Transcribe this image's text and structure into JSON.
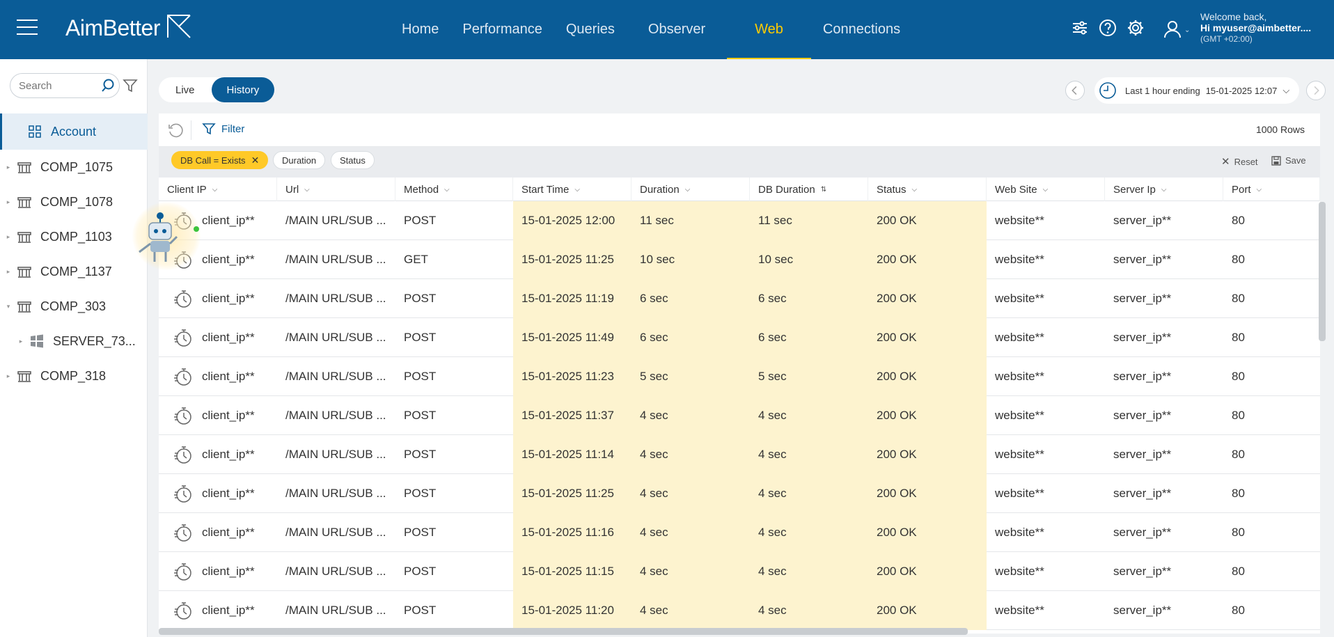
{
  "brand": {
    "name": "AimBetter"
  },
  "nav": {
    "items": [
      {
        "label": "Home"
      },
      {
        "label": "Performance"
      },
      {
        "label": "Queries"
      },
      {
        "label": "Observer"
      },
      {
        "label": "Web"
      },
      {
        "label": "Connections"
      }
    ],
    "active": "Web"
  },
  "user": {
    "welcome": "Welcome back,",
    "name": "Hi myuser@aimbetter....",
    "timezone": "(GMT +02:00)"
  },
  "sidebar": {
    "search_placeholder": "Search",
    "items": [
      {
        "label": "Account",
        "icon": "grid-icon",
        "active": true
      },
      {
        "label": "COMP_1075",
        "icon": "building-icon"
      },
      {
        "label": "COMP_1078",
        "icon": "building-icon"
      },
      {
        "label": "COMP_1103",
        "icon": "building-icon"
      },
      {
        "label": "COMP_1137",
        "icon": "building-icon"
      },
      {
        "label": "COMP_303",
        "icon": "building-icon",
        "expanded": true
      },
      {
        "label": "SERVER_73...",
        "icon": "windows-icon",
        "sub": true
      },
      {
        "label": "COMP_318",
        "icon": "building-icon"
      }
    ]
  },
  "view_toggle": {
    "live": "Live",
    "history": "History",
    "active": "History"
  },
  "time_range": {
    "label": "Last 1 hour ending",
    "end": "15-01-2025 12:07"
  },
  "toolbar": {
    "filter_label": "Filter",
    "rows_count": "1000 Rows"
  },
  "chips": {
    "active_filter": "DB Call = Exists",
    "duration": "Duration",
    "status": "Status",
    "reset": "Reset",
    "save": "Save"
  },
  "table": {
    "columns": [
      "Client IP",
      "Url",
      "Method",
      "Start Time",
      "Duration",
      "DB Duration",
      "Status",
      "Web Site",
      "Server Ip",
      "Port"
    ],
    "rows": [
      [
        "client_ip**",
        "/MAIN URL/SUB ...",
        "POST",
        "15-01-2025 12:00",
        "11 sec",
        "11 sec",
        "200 OK",
        "website**",
        "server_ip**",
        "80"
      ],
      [
        "client_ip**",
        "/MAIN URL/SUB ...",
        "GET",
        "15-01-2025 11:25",
        "10 sec",
        "10 sec",
        "200 OK",
        "website**",
        "server_ip**",
        "80"
      ],
      [
        "client_ip**",
        "/MAIN URL/SUB ...",
        "POST",
        "15-01-2025 11:19",
        "6 sec",
        "6 sec",
        "200 OK",
        "website**",
        "server_ip**",
        "80"
      ],
      [
        "client_ip**",
        "/MAIN URL/SUB ...",
        "POST",
        "15-01-2025 11:49",
        "6 sec",
        "6 sec",
        "200 OK",
        "website**",
        "server_ip**",
        "80"
      ],
      [
        "client_ip**",
        "/MAIN URL/SUB ...",
        "POST",
        "15-01-2025 11:23",
        "5 sec",
        "5 sec",
        "200 OK",
        "website**",
        "server_ip**",
        "80"
      ],
      [
        "client_ip**",
        "/MAIN URL/SUB ...",
        "POST",
        "15-01-2025 11:37",
        "4 sec",
        "4 sec",
        "200 OK",
        "website**",
        "server_ip**",
        "80"
      ],
      [
        "client_ip**",
        "/MAIN URL/SUB ...",
        "POST",
        "15-01-2025 11:14",
        "4 sec",
        "4 sec",
        "200 OK",
        "website**",
        "server_ip**",
        "80"
      ],
      [
        "client_ip**",
        "/MAIN URL/SUB ...",
        "POST",
        "15-01-2025 11:25",
        "4 sec",
        "4 sec",
        "200 OK",
        "website**",
        "server_ip**",
        "80"
      ],
      [
        "client_ip**",
        "/MAIN URL/SUB ...",
        "POST",
        "15-01-2025 11:16",
        "4 sec",
        "4 sec",
        "200 OK",
        "website**",
        "server_ip**",
        "80"
      ],
      [
        "client_ip**",
        "/MAIN URL/SUB ...",
        "POST",
        "15-01-2025 11:15",
        "4 sec",
        "4 sec",
        "200 OK",
        "website**",
        "server_ip**",
        "80"
      ],
      [
        "client_ip**",
        "/MAIN URL/SUB ...",
        "POST",
        "15-01-2025 11:20",
        "4 sec",
        "4 sec",
        "200 OK",
        "website**",
        "server_ip**",
        "80"
      ]
    ]
  },
  "colors": {
    "brand_blue": "#0a5c97",
    "accent_yellow": "#ffcc00",
    "highlight_cell": "#fdf3cf"
  }
}
